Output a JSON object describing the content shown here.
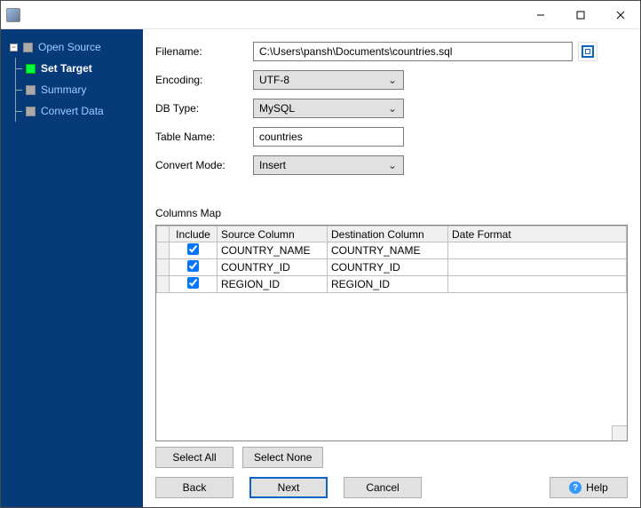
{
  "sidebar": {
    "items": [
      {
        "label": "Open Source",
        "active": false
      },
      {
        "label": "Set Target",
        "active": true
      },
      {
        "label": "Summary",
        "active": false
      },
      {
        "label": "Convert Data",
        "active": false
      }
    ]
  },
  "form": {
    "filename_label": "Filename:",
    "filename_value": "C:\\Users\\pansh\\Documents\\countries.sql",
    "encoding_label": "Encoding:",
    "encoding_value": "UTF-8",
    "dbtype_label": "DB Type:",
    "dbtype_value": "MySQL",
    "tablename_label": "Table Name:",
    "tablename_value": "countries",
    "convertmode_label": "Convert Mode:",
    "convertmode_value": "Insert"
  },
  "columns_map": {
    "title": "Columns Map",
    "headers": {
      "include": "Include",
      "source": "Source Column",
      "destination": "Destination Column",
      "dateformat": "Date Format"
    },
    "rows": [
      {
        "include": true,
        "source": "COUNTRY_NAME",
        "destination": "COUNTRY_NAME",
        "dateformat": ""
      },
      {
        "include": true,
        "source": "COUNTRY_ID",
        "destination": "COUNTRY_ID",
        "dateformat": ""
      },
      {
        "include": true,
        "source": "REGION_ID",
        "destination": "REGION_ID",
        "dateformat": ""
      }
    ]
  },
  "buttons": {
    "select_all": "Select All",
    "select_none": "Select None",
    "back": "Back",
    "next": "Next",
    "cancel": "Cancel",
    "help": "Help"
  }
}
